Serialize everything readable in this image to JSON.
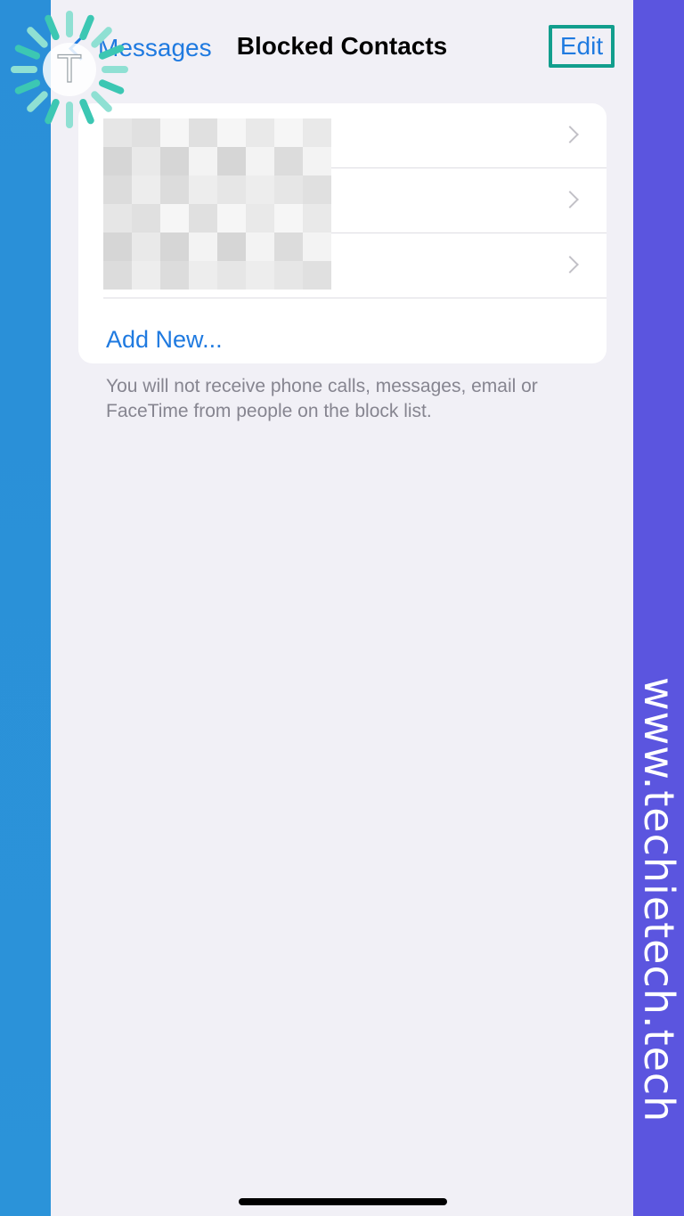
{
  "nav": {
    "back_label": "Messages",
    "title": "Blocked Contacts",
    "edit_label": "Edit"
  },
  "blocked_list": {
    "rows": [
      {
        "name": "",
        "chevron": "chevron-right-icon"
      },
      {
        "name": "",
        "chevron": "chevron-right-icon"
      },
      {
        "name": "",
        "chevron": "chevron-right-icon"
      }
    ],
    "add_new_label": "Add New..."
  },
  "footer_note": "You will not receive phone calls, messages, email or FaceTime from people on the block list.",
  "watermark": {
    "text": "www.techietech.tech",
    "logo_letter": "T"
  },
  "colors": {
    "accent": "#1f7ae0",
    "highlight_box": "#129e8d",
    "left_band": "#2a8fd8",
    "right_band": "#5b55df",
    "background": "#f1f0f6"
  }
}
